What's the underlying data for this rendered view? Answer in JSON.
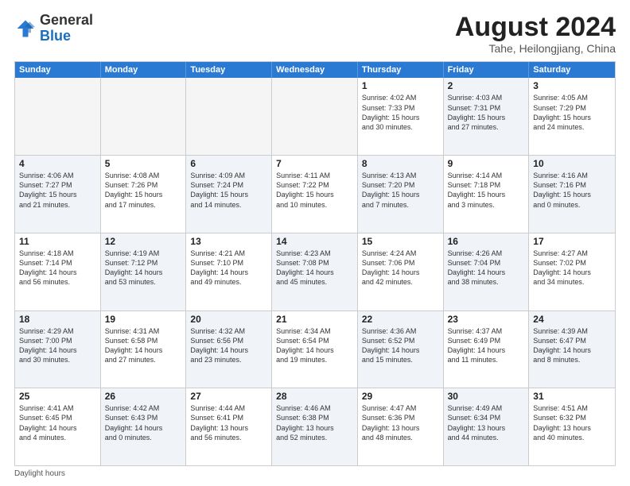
{
  "logo": {
    "general": "General",
    "blue": "Blue"
  },
  "header": {
    "month": "August 2024",
    "location": "Tahe, Heilongjiang, China"
  },
  "weekdays": [
    "Sunday",
    "Monday",
    "Tuesday",
    "Wednesday",
    "Thursday",
    "Friday",
    "Saturday"
  ],
  "rows": [
    [
      {
        "day": "",
        "info": "",
        "shaded": true,
        "empty": true
      },
      {
        "day": "",
        "info": "",
        "shaded": true,
        "empty": true
      },
      {
        "day": "",
        "info": "",
        "shaded": true,
        "empty": true
      },
      {
        "day": "",
        "info": "",
        "shaded": true,
        "empty": true
      },
      {
        "day": "1",
        "info": "Sunrise: 4:02 AM\nSunset: 7:33 PM\nDaylight: 15 hours\nand 30 minutes.",
        "shaded": false
      },
      {
        "day": "2",
        "info": "Sunrise: 4:03 AM\nSunset: 7:31 PM\nDaylight: 15 hours\nand 27 minutes.",
        "shaded": true
      },
      {
        "day": "3",
        "info": "Sunrise: 4:05 AM\nSunset: 7:29 PM\nDaylight: 15 hours\nand 24 minutes.",
        "shaded": false
      }
    ],
    [
      {
        "day": "4",
        "info": "Sunrise: 4:06 AM\nSunset: 7:27 PM\nDaylight: 15 hours\nand 21 minutes.",
        "shaded": true
      },
      {
        "day": "5",
        "info": "Sunrise: 4:08 AM\nSunset: 7:26 PM\nDaylight: 15 hours\nand 17 minutes.",
        "shaded": false
      },
      {
        "day": "6",
        "info": "Sunrise: 4:09 AM\nSunset: 7:24 PM\nDaylight: 15 hours\nand 14 minutes.",
        "shaded": true
      },
      {
        "day": "7",
        "info": "Sunrise: 4:11 AM\nSunset: 7:22 PM\nDaylight: 15 hours\nand 10 minutes.",
        "shaded": false
      },
      {
        "day": "8",
        "info": "Sunrise: 4:13 AM\nSunset: 7:20 PM\nDaylight: 15 hours\nand 7 minutes.",
        "shaded": true
      },
      {
        "day": "9",
        "info": "Sunrise: 4:14 AM\nSunset: 7:18 PM\nDaylight: 15 hours\nand 3 minutes.",
        "shaded": false
      },
      {
        "day": "10",
        "info": "Sunrise: 4:16 AM\nSunset: 7:16 PM\nDaylight: 15 hours\nand 0 minutes.",
        "shaded": true
      }
    ],
    [
      {
        "day": "11",
        "info": "Sunrise: 4:18 AM\nSunset: 7:14 PM\nDaylight: 14 hours\nand 56 minutes.",
        "shaded": false
      },
      {
        "day": "12",
        "info": "Sunrise: 4:19 AM\nSunset: 7:12 PM\nDaylight: 14 hours\nand 53 minutes.",
        "shaded": true
      },
      {
        "day": "13",
        "info": "Sunrise: 4:21 AM\nSunset: 7:10 PM\nDaylight: 14 hours\nand 49 minutes.",
        "shaded": false
      },
      {
        "day": "14",
        "info": "Sunrise: 4:23 AM\nSunset: 7:08 PM\nDaylight: 14 hours\nand 45 minutes.",
        "shaded": true
      },
      {
        "day": "15",
        "info": "Sunrise: 4:24 AM\nSunset: 7:06 PM\nDaylight: 14 hours\nand 42 minutes.",
        "shaded": false
      },
      {
        "day": "16",
        "info": "Sunrise: 4:26 AM\nSunset: 7:04 PM\nDaylight: 14 hours\nand 38 minutes.",
        "shaded": true
      },
      {
        "day": "17",
        "info": "Sunrise: 4:27 AM\nSunset: 7:02 PM\nDaylight: 14 hours\nand 34 minutes.",
        "shaded": false
      }
    ],
    [
      {
        "day": "18",
        "info": "Sunrise: 4:29 AM\nSunset: 7:00 PM\nDaylight: 14 hours\nand 30 minutes.",
        "shaded": true
      },
      {
        "day": "19",
        "info": "Sunrise: 4:31 AM\nSunset: 6:58 PM\nDaylight: 14 hours\nand 27 minutes.",
        "shaded": false
      },
      {
        "day": "20",
        "info": "Sunrise: 4:32 AM\nSunset: 6:56 PM\nDaylight: 14 hours\nand 23 minutes.",
        "shaded": true
      },
      {
        "day": "21",
        "info": "Sunrise: 4:34 AM\nSunset: 6:54 PM\nDaylight: 14 hours\nand 19 minutes.",
        "shaded": false
      },
      {
        "day": "22",
        "info": "Sunrise: 4:36 AM\nSunset: 6:52 PM\nDaylight: 14 hours\nand 15 minutes.",
        "shaded": true
      },
      {
        "day": "23",
        "info": "Sunrise: 4:37 AM\nSunset: 6:49 PM\nDaylight: 14 hours\nand 11 minutes.",
        "shaded": false
      },
      {
        "day": "24",
        "info": "Sunrise: 4:39 AM\nSunset: 6:47 PM\nDaylight: 14 hours\nand 8 minutes.",
        "shaded": true
      }
    ],
    [
      {
        "day": "25",
        "info": "Sunrise: 4:41 AM\nSunset: 6:45 PM\nDaylight: 14 hours\nand 4 minutes.",
        "shaded": false
      },
      {
        "day": "26",
        "info": "Sunrise: 4:42 AM\nSunset: 6:43 PM\nDaylight: 14 hours\nand 0 minutes.",
        "shaded": true
      },
      {
        "day": "27",
        "info": "Sunrise: 4:44 AM\nSunset: 6:41 PM\nDaylight: 13 hours\nand 56 minutes.",
        "shaded": false
      },
      {
        "day": "28",
        "info": "Sunrise: 4:46 AM\nSunset: 6:38 PM\nDaylight: 13 hours\nand 52 minutes.",
        "shaded": true
      },
      {
        "day": "29",
        "info": "Sunrise: 4:47 AM\nSunset: 6:36 PM\nDaylight: 13 hours\nand 48 minutes.",
        "shaded": false
      },
      {
        "day": "30",
        "info": "Sunrise: 4:49 AM\nSunset: 6:34 PM\nDaylight: 13 hours\nand 44 minutes.",
        "shaded": true
      },
      {
        "day": "31",
        "info": "Sunrise: 4:51 AM\nSunset: 6:32 PM\nDaylight: 13 hours\nand 40 minutes.",
        "shaded": false
      }
    ]
  ],
  "footer": {
    "note": "Daylight hours"
  }
}
